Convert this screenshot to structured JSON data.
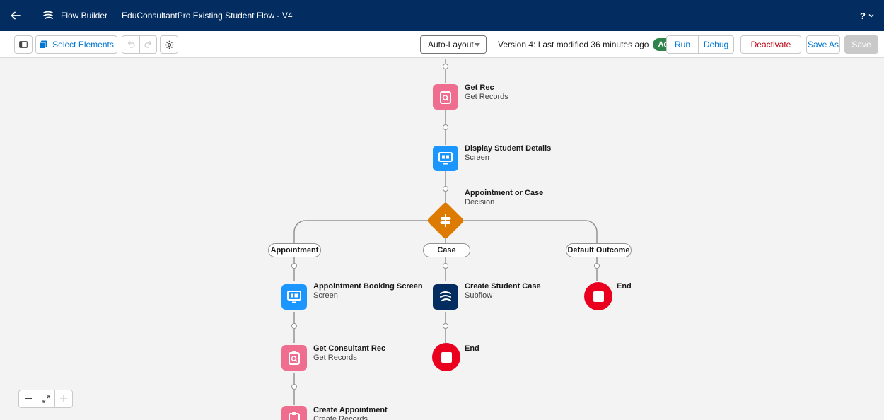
{
  "header": {
    "app_name": "Flow Builder",
    "flow_title": "EduConsultantPro Existing Student Flow - V4",
    "help_label": "?"
  },
  "toolbar": {
    "select_elements_label": "Select Elements",
    "layout_value": "Auto-Layout",
    "version_text": "Version 4: Last modified 36 minutes ago",
    "status_badge": "Active",
    "run_label": "Run",
    "debug_label": "Debug",
    "deactivate_label": "Deactivate",
    "save_as_label": "Save As",
    "save_label": "Save"
  },
  "canvas": {
    "nodes": {
      "get_rec": {
        "title": "Get Rec",
        "type": "Get Records"
      },
      "display_student": {
        "title": "Display Student Details",
        "type": "Screen"
      },
      "decision": {
        "title": "Appointment or Case",
        "type": "Decision"
      },
      "appointment_booking": {
        "title": "Appointment Booking Screen",
        "type": "Screen"
      },
      "get_consultant": {
        "title": "Get Consultant Rec",
        "type": "Get Records"
      },
      "create_appointment": {
        "title": "Create Appointment",
        "type": "Create Records"
      },
      "create_case": {
        "title": "Create Student Case",
        "type": "Subflow"
      },
      "end_case": {
        "title": "End"
      },
      "end_default": {
        "title": "End"
      }
    },
    "outcomes": {
      "appointment": "Appointment",
      "case": "Case",
      "default": "Default Outcome"
    }
  },
  "colors": {
    "header_bg": "#032d60",
    "get_records": "#ef6e8f",
    "screen": "#1b96ff",
    "subflow": "#032d60",
    "decision": "#dd7a01",
    "end": "#ea001e",
    "active": "#2e844a"
  }
}
